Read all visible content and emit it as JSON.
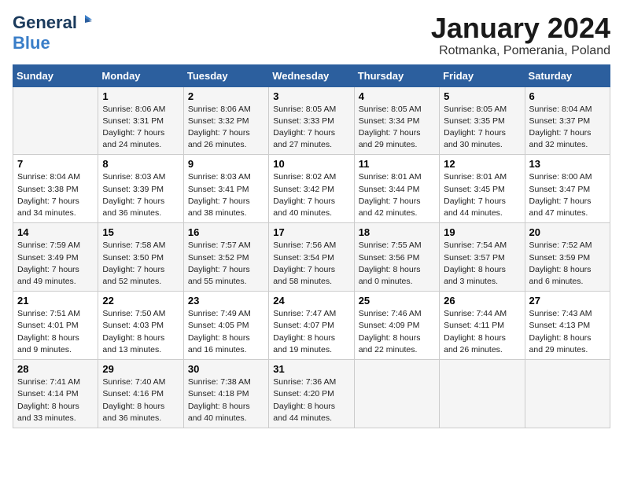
{
  "logo": {
    "line1": "General",
    "line2": "Blue"
  },
  "title": "January 2024",
  "subtitle": "Rotmanka, Pomerania, Poland",
  "days_header": [
    "Sunday",
    "Monday",
    "Tuesday",
    "Wednesday",
    "Thursday",
    "Friday",
    "Saturday"
  ],
  "weeks": [
    [
      {
        "num": "",
        "info": ""
      },
      {
        "num": "1",
        "info": "Sunrise: 8:06 AM\nSunset: 3:31 PM\nDaylight: 7 hours\nand 24 minutes."
      },
      {
        "num": "2",
        "info": "Sunrise: 8:06 AM\nSunset: 3:32 PM\nDaylight: 7 hours\nand 26 minutes."
      },
      {
        "num": "3",
        "info": "Sunrise: 8:05 AM\nSunset: 3:33 PM\nDaylight: 7 hours\nand 27 minutes."
      },
      {
        "num": "4",
        "info": "Sunrise: 8:05 AM\nSunset: 3:34 PM\nDaylight: 7 hours\nand 29 minutes."
      },
      {
        "num": "5",
        "info": "Sunrise: 8:05 AM\nSunset: 3:35 PM\nDaylight: 7 hours\nand 30 minutes."
      },
      {
        "num": "6",
        "info": "Sunrise: 8:04 AM\nSunset: 3:37 PM\nDaylight: 7 hours\nand 32 minutes."
      }
    ],
    [
      {
        "num": "7",
        "info": "Sunrise: 8:04 AM\nSunset: 3:38 PM\nDaylight: 7 hours\nand 34 minutes."
      },
      {
        "num": "8",
        "info": "Sunrise: 8:03 AM\nSunset: 3:39 PM\nDaylight: 7 hours\nand 36 minutes."
      },
      {
        "num": "9",
        "info": "Sunrise: 8:03 AM\nSunset: 3:41 PM\nDaylight: 7 hours\nand 38 minutes."
      },
      {
        "num": "10",
        "info": "Sunrise: 8:02 AM\nSunset: 3:42 PM\nDaylight: 7 hours\nand 40 minutes."
      },
      {
        "num": "11",
        "info": "Sunrise: 8:01 AM\nSunset: 3:44 PM\nDaylight: 7 hours\nand 42 minutes."
      },
      {
        "num": "12",
        "info": "Sunrise: 8:01 AM\nSunset: 3:45 PM\nDaylight: 7 hours\nand 44 minutes."
      },
      {
        "num": "13",
        "info": "Sunrise: 8:00 AM\nSunset: 3:47 PM\nDaylight: 7 hours\nand 47 minutes."
      }
    ],
    [
      {
        "num": "14",
        "info": "Sunrise: 7:59 AM\nSunset: 3:49 PM\nDaylight: 7 hours\nand 49 minutes."
      },
      {
        "num": "15",
        "info": "Sunrise: 7:58 AM\nSunset: 3:50 PM\nDaylight: 7 hours\nand 52 minutes."
      },
      {
        "num": "16",
        "info": "Sunrise: 7:57 AM\nSunset: 3:52 PM\nDaylight: 7 hours\nand 55 minutes."
      },
      {
        "num": "17",
        "info": "Sunrise: 7:56 AM\nSunset: 3:54 PM\nDaylight: 7 hours\nand 58 minutes."
      },
      {
        "num": "18",
        "info": "Sunrise: 7:55 AM\nSunset: 3:56 PM\nDaylight: 8 hours\nand 0 minutes."
      },
      {
        "num": "19",
        "info": "Sunrise: 7:54 AM\nSunset: 3:57 PM\nDaylight: 8 hours\nand 3 minutes."
      },
      {
        "num": "20",
        "info": "Sunrise: 7:52 AM\nSunset: 3:59 PM\nDaylight: 8 hours\nand 6 minutes."
      }
    ],
    [
      {
        "num": "21",
        "info": "Sunrise: 7:51 AM\nSunset: 4:01 PM\nDaylight: 8 hours\nand 9 minutes."
      },
      {
        "num": "22",
        "info": "Sunrise: 7:50 AM\nSunset: 4:03 PM\nDaylight: 8 hours\nand 13 minutes."
      },
      {
        "num": "23",
        "info": "Sunrise: 7:49 AM\nSunset: 4:05 PM\nDaylight: 8 hours\nand 16 minutes."
      },
      {
        "num": "24",
        "info": "Sunrise: 7:47 AM\nSunset: 4:07 PM\nDaylight: 8 hours\nand 19 minutes."
      },
      {
        "num": "25",
        "info": "Sunrise: 7:46 AM\nSunset: 4:09 PM\nDaylight: 8 hours\nand 22 minutes."
      },
      {
        "num": "26",
        "info": "Sunrise: 7:44 AM\nSunset: 4:11 PM\nDaylight: 8 hours\nand 26 minutes."
      },
      {
        "num": "27",
        "info": "Sunrise: 7:43 AM\nSunset: 4:13 PM\nDaylight: 8 hours\nand 29 minutes."
      }
    ],
    [
      {
        "num": "28",
        "info": "Sunrise: 7:41 AM\nSunset: 4:14 PM\nDaylight: 8 hours\nand 33 minutes."
      },
      {
        "num": "29",
        "info": "Sunrise: 7:40 AM\nSunset: 4:16 PM\nDaylight: 8 hours\nand 36 minutes."
      },
      {
        "num": "30",
        "info": "Sunrise: 7:38 AM\nSunset: 4:18 PM\nDaylight: 8 hours\nand 40 minutes."
      },
      {
        "num": "31",
        "info": "Sunrise: 7:36 AM\nSunset: 4:20 PM\nDaylight: 8 hours\nand 44 minutes."
      },
      {
        "num": "",
        "info": ""
      },
      {
        "num": "",
        "info": ""
      },
      {
        "num": "",
        "info": ""
      }
    ]
  ]
}
